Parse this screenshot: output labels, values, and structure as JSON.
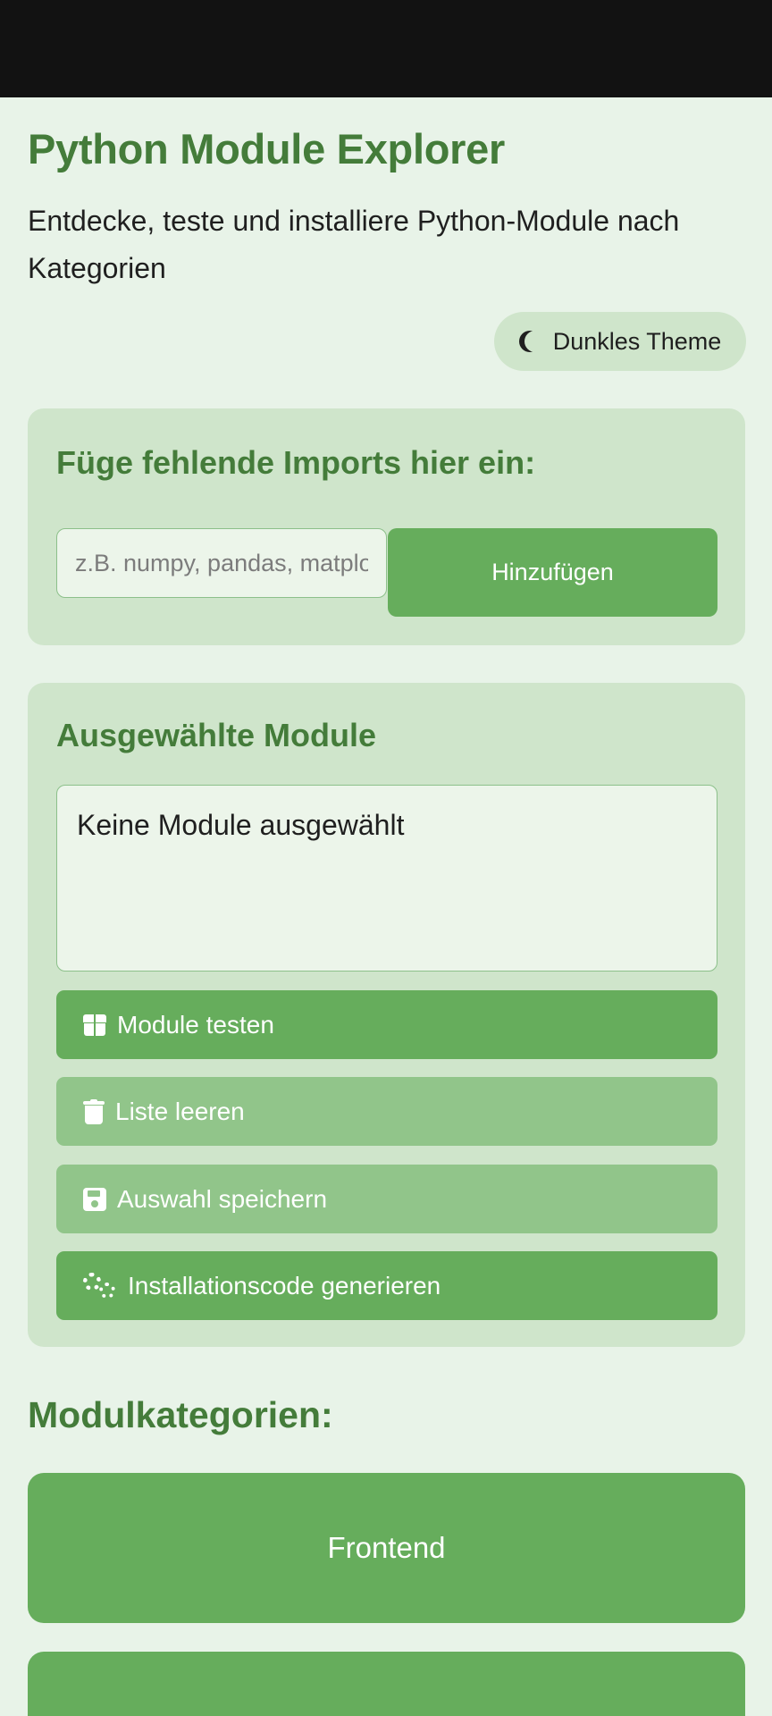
{
  "header": {
    "title": "Python Module Explorer",
    "subtitle": "Entdecke, teste und installiere Python-Module nach Kategorien",
    "theme_button_label": "Dunkles Theme",
    "theme_icon": "moon-icon"
  },
  "import_card": {
    "title": "Füge fehlende Imports hier ein:",
    "input_value": "",
    "input_placeholder": "z.B. numpy, pandas, matplotlib",
    "add_button_label": "Hinzufügen"
  },
  "selected_card": {
    "title": "Ausgewählte Module",
    "empty_text": "Keine Module ausgewählt",
    "actions": [
      {
        "label": "Module testen",
        "icon": "gift-icon"
      },
      {
        "label": "Liste leeren",
        "icon": "trash-icon"
      },
      {
        "label": "Auswahl speichern",
        "icon": "save-icon"
      },
      {
        "label": "Installationscode generieren",
        "icon": "cogs-icon"
      }
    ]
  },
  "categories": {
    "title": "Modulkategorien:",
    "items": [
      {
        "label": "Frontend"
      },
      {
        "label": ""
      }
    ]
  },
  "colors": {
    "primary": "#66ad5c",
    "secondary": "#91c58a",
    "heading": "#447c3a",
    "card_bg": "#cfe5cb",
    "page_bg": "#e8f3e8"
  }
}
